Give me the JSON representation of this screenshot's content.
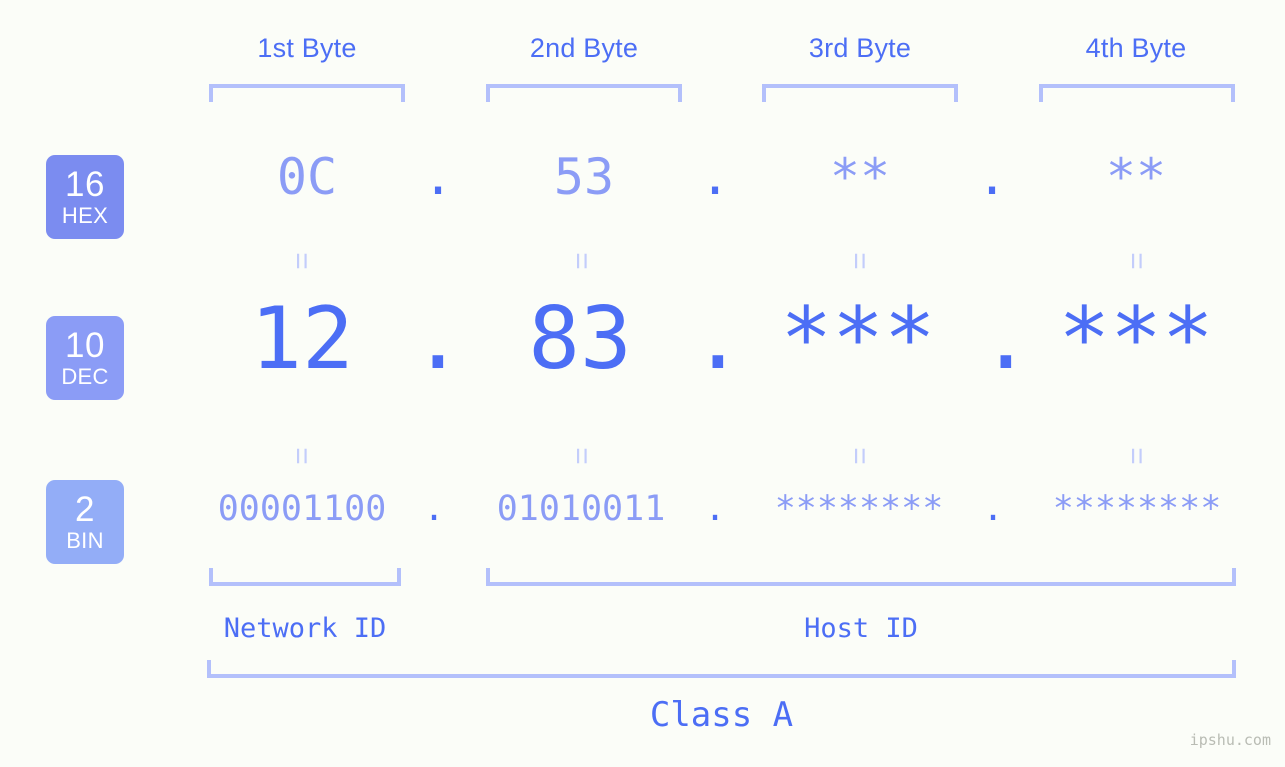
{
  "background_color": "#fbfdf8",
  "accent_color": "#4c6ef5",
  "accent_light_color": "#8b9cf6",
  "bracket_color": "#b3c0fb",
  "header": {
    "bytes": [
      {
        "label": "1st Byte"
      },
      {
        "label": "2nd Byte"
      },
      {
        "label": "3rd Byte"
      },
      {
        "label": "4th Byte"
      }
    ]
  },
  "rows": [
    {
      "id": "hex",
      "badge_number": "16",
      "badge_name": "HEX",
      "badge_color": "#7b8cf0",
      "values": [
        "0C",
        "53",
        "**",
        "**"
      ],
      "separator": "."
    },
    {
      "id": "dec",
      "badge_number": "10",
      "badge_name": "DEC",
      "badge_color": "#8b9cf6",
      "values": [
        "12",
        "83",
        "***",
        "***"
      ],
      "separator": "."
    },
    {
      "id": "bin",
      "badge_number": "2",
      "badge_name": "BIN",
      "badge_color": "#93adf7",
      "values": [
        "00001100",
        "01010011",
        "********",
        "********"
      ],
      "separator": "."
    }
  ],
  "equality_marks": {
    "glyph": "=",
    "count_per_gap": 4,
    "gaps": 2
  },
  "id_captions": [
    {
      "label": "Network ID"
    },
    {
      "label": "Host ID"
    }
  ],
  "class_caption": {
    "label": "Class A"
  },
  "watermark": {
    "text": "ipshu.com"
  },
  "chart_data": {
    "type": "table",
    "title": "IPv4 address byte breakdown — Class A",
    "columns": [
      "1st Byte",
      "2nd Byte",
      "3rd Byte",
      "4th Byte"
    ],
    "rows": [
      {
        "radix": 16,
        "radix_name": "HEX",
        "cells": [
          "0C",
          "53",
          "**",
          "**"
        ]
      },
      {
        "radix": 10,
        "radix_name": "DEC",
        "cells": [
          "12",
          "83",
          "***",
          "***"
        ]
      },
      {
        "radix": 2,
        "radix_name": "BIN",
        "cells": [
          "00001100",
          "01010011",
          "********",
          "********"
        ]
      }
    ],
    "network_id_bytes": [
      1
    ],
    "host_id_bytes": [
      2,
      3,
      4
    ],
    "address_class": "Class A"
  }
}
